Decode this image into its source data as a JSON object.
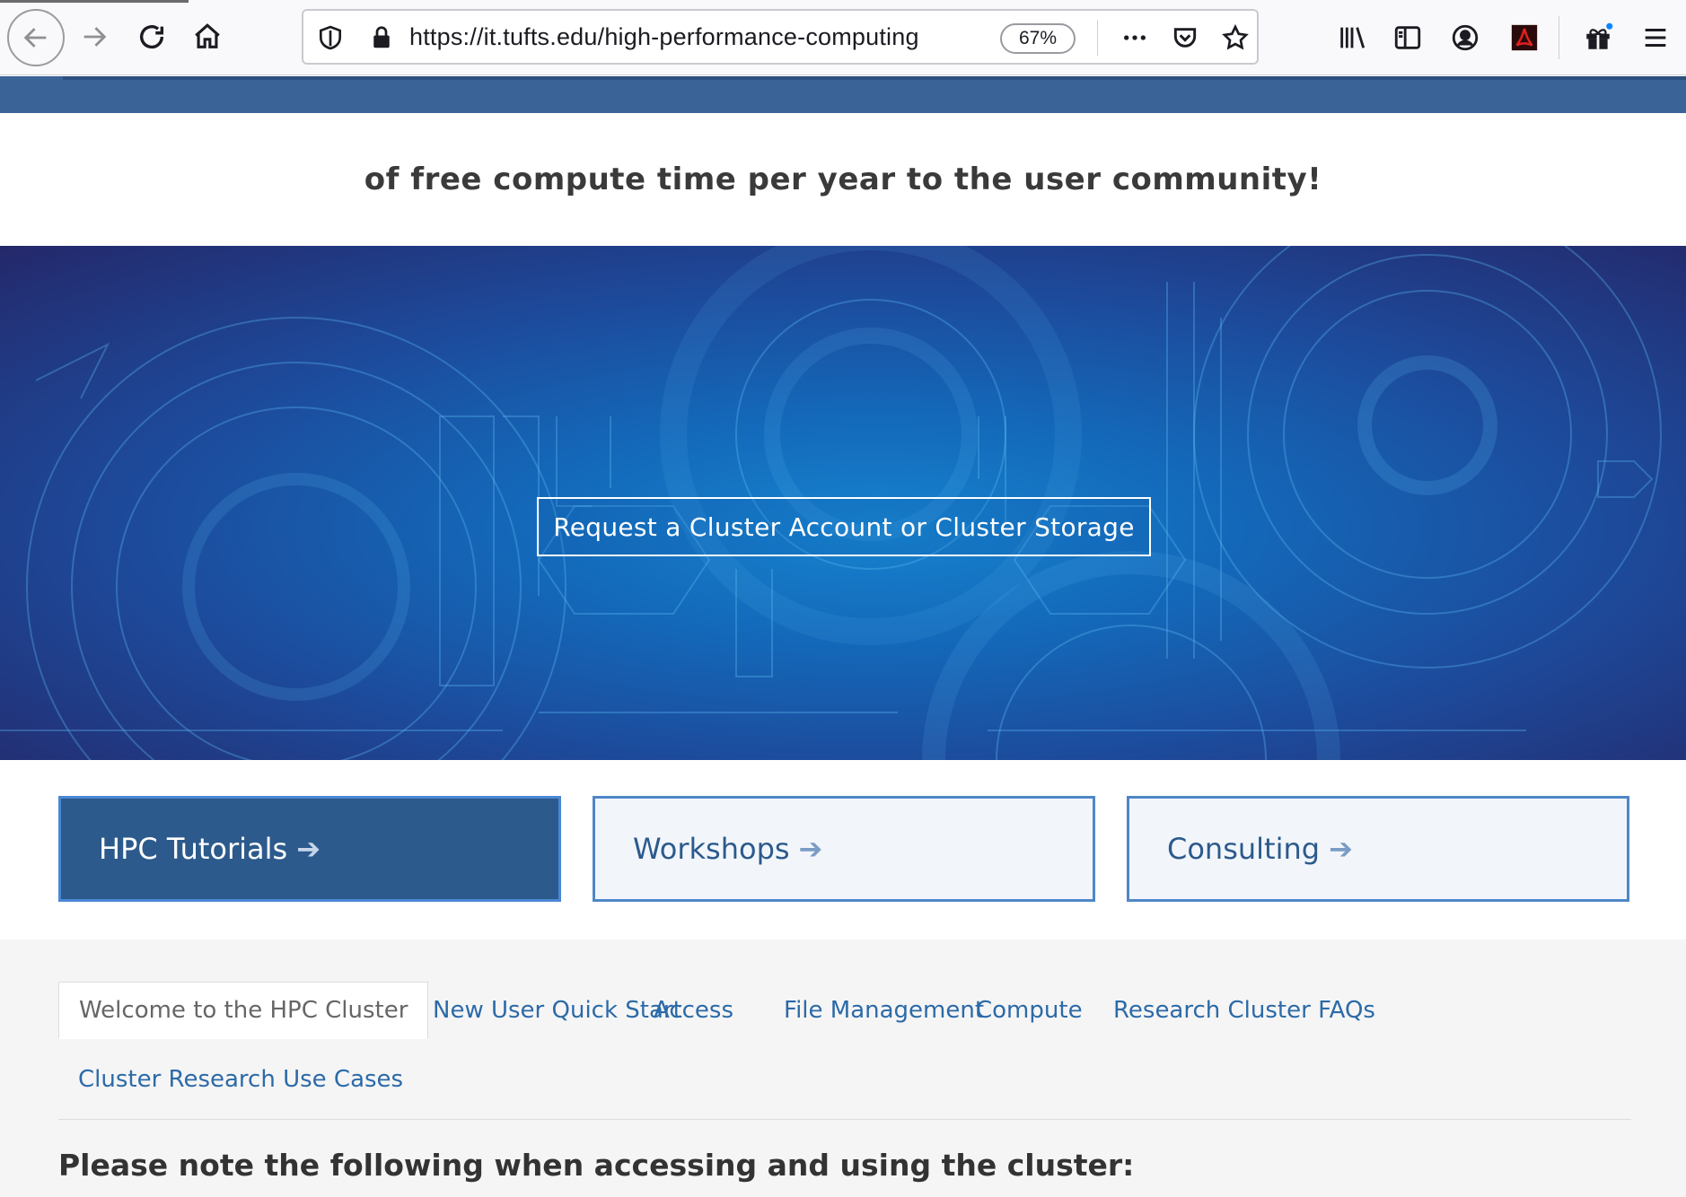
{
  "browser": {
    "url": "https://it.tufts.edu/high-performance-computing",
    "zoom": "67%",
    "icons": [
      "back-icon",
      "forward-icon",
      "reload-icon",
      "home-icon",
      "shield-icon",
      "lock-icon",
      "more-icon",
      "pocket-icon",
      "star-icon",
      "library-icon",
      "sidebar-icon",
      "account-icon",
      "pdf-icon",
      "gift-icon",
      "menu-icon"
    ]
  },
  "intro": {
    "text": "of free compute time per year to the user community!"
  },
  "hero": {
    "cta_label": "Request a Cluster Account or Cluster Storage"
  },
  "cards": [
    {
      "label": "HPC Tutorials",
      "arrow": "➔"
    },
    {
      "label": "Workshops",
      "arrow": "➔"
    },
    {
      "label": "Consulting",
      "arrow": "➔"
    }
  ],
  "tabs": [
    {
      "label": "Welcome to the HPC Cluster",
      "active": true
    },
    {
      "label": "New User Quick Start"
    },
    {
      "label": "Access"
    },
    {
      "label": "File Management"
    },
    {
      "label": "Compute"
    },
    {
      "label": "Research Cluster FAQs"
    },
    {
      "label": "Cluster Research Use Cases"
    }
  ],
  "notice": {
    "text": "Please note the following when accessing and using the cluster:"
  },
  "colors": {
    "band": "#3a6397",
    "hero_center": "#1683cf",
    "hero_edge": "#24286a",
    "card_primary": "#2c5a8c",
    "card_border": "#4f87c7",
    "link": "#2c6aa8"
  }
}
